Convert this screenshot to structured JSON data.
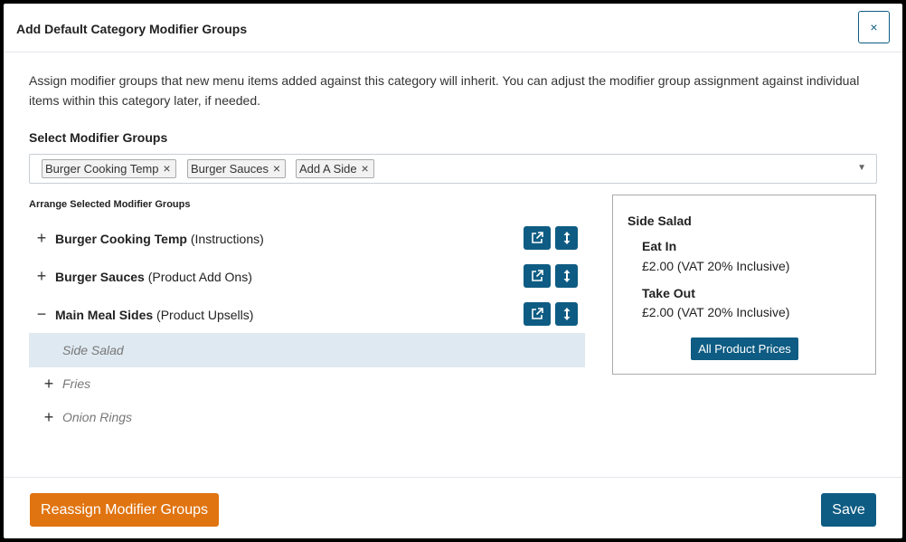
{
  "dialog": {
    "title": "Add Default Category Modifier Groups",
    "close_label": "×"
  },
  "description": "Assign modifier groups that new menu items added against this category will inherit. You can adjust the modifier group assignment against individual items within this category later, if needed.",
  "select": {
    "label": "Select Modifier Groups",
    "chips": [
      "Burger Cooking Temp",
      "Burger Sauces",
      "Add A Side"
    ],
    "chip_remove": "×",
    "caret": "▼"
  },
  "arrange": {
    "label": "Arrange Selected Modifier Groups",
    "groups": [
      {
        "name": "Burger Cooking Temp",
        "type": "(Instructions)",
        "sign": "+"
      },
      {
        "name": "Burger Sauces",
        "type": "(Product Add Ons)",
        "sign": "+"
      },
      {
        "name": "Main Meal Sides",
        "type": "(Product Upsells)",
        "sign": "−"
      }
    ],
    "items": [
      {
        "name": "Side Salad",
        "sign": ""
      },
      {
        "name": "Fries",
        "sign": "+"
      },
      {
        "name": "Onion Rings",
        "sign": "+"
      }
    ],
    "icons": [
      "external-link-icon",
      "reorder-arrows-icon"
    ]
  },
  "price_panel": {
    "title": "Side Salad",
    "entries": [
      {
        "label": "Eat In",
        "value": "£2.00 (VAT 20% Inclusive)"
      },
      {
        "label": "Take Out",
        "value": "£2.00 (VAT 20% Inclusive)"
      }
    ],
    "button_label": "All Product Prices"
  },
  "footer": {
    "reassign_label": "Reassign Modifier Groups",
    "save_label": "Save"
  },
  "colors": {
    "primary": "#0e5c83",
    "accent_orange": "#e07410",
    "selected_row": "#dfe9f1"
  }
}
